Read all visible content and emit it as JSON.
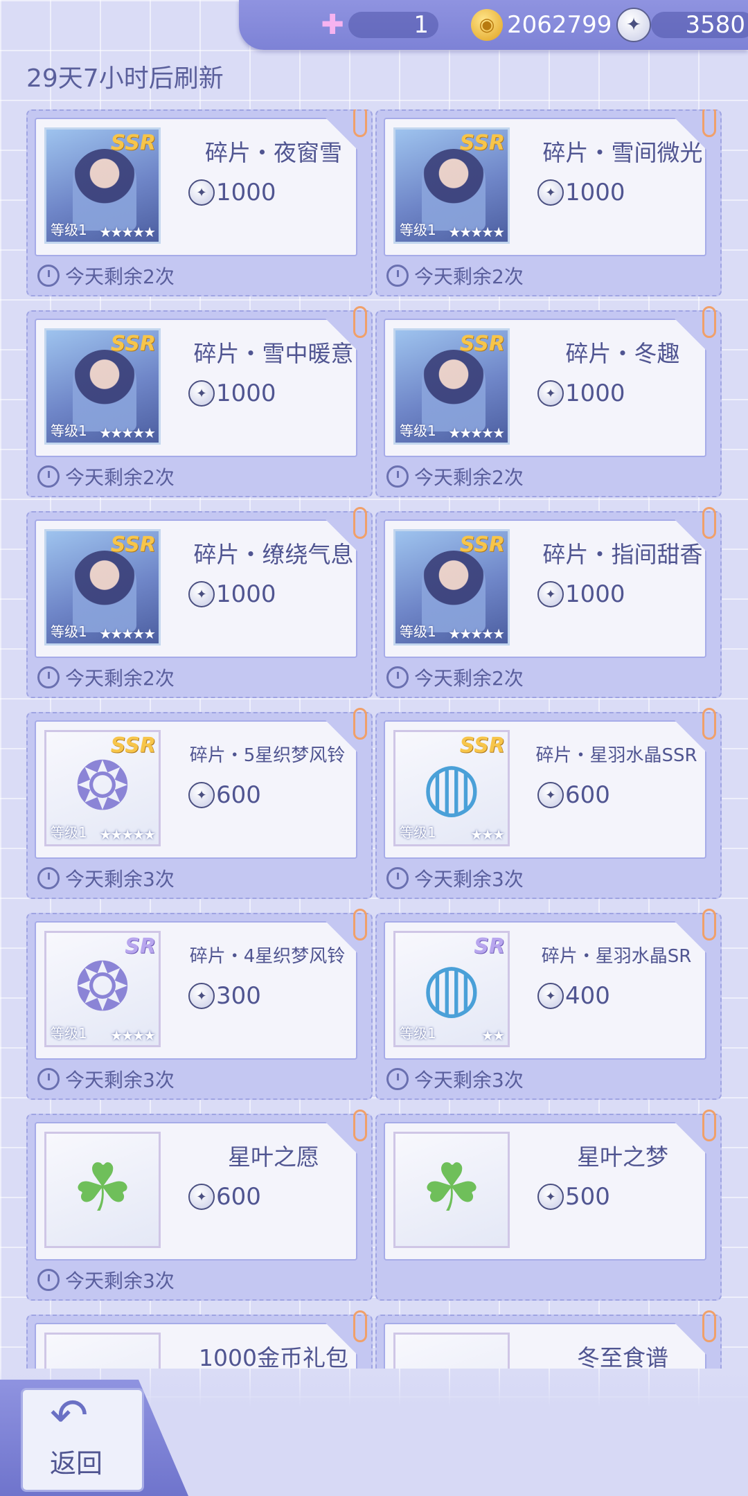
{
  "currency": {
    "swan": {
      "icon": "swan-plus-icon",
      "value": "1"
    },
    "coins": {
      "icon": "gold-coin-icon",
      "value": "2062799"
    },
    "stars": {
      "icon": "star-coin-icon",
      "value": "3580"
    }
  },
  "refresh_text": "29天7小时后刷新",
  "cards": [
    {
      "name": "碎片・夜窗雪",
      "price": "1000",
      "limit": "今天剩余2次",
      "rarity": "SSR",
      "level": "等级1",
      "stars": "★★★★★",
      "thumb": "character"
    },
    {
      "name": "碎片・雪间微光",
      "price": "1000",
      "limit": "今天剩余2次",
      "rarity": "SSR",
      "level": "等级1",
      "stars": "★★★★★",
      "thumb": "character"
    },
    {
      "name": "碎片・雪中暖意",
      "price": "1000",
      "limit": "今天剩余2次",
      "rarity": "SSR",
      "level": "等级1",
      "stars": "★★★★★",
      "thumb": "character"
    },
    {
      "name": "碎片・冬趣",
      "price": "1000",
      "limit": "今天剩余2次",
      "rarity": "SSR",
      "level": "等级1",
      "stars": "★★★★★",
      "thumb": "character"
    },
    {
      "name": "碎片・缭绕气息",
      "price": "1000",
      "limit": "今天剩余2次",
      "rarity": "SSR",
      "level": "等级1",
      "stars": "★★★★★",
      "thumb": "character"
    },
    {
      "name": "碎片・指间甜香",
      "price": "1000",
      "limit": "今天剩余2次",
      "rarity": "SSR",
      "level": "等级1",
      "stars": "★★★★★",
      "thumb": "character"
    },
    {
      "name": "碎片・5星织梦风铃",
      "price": "600",
      "limit": "今天剩余3次",
      "rarity": "SSR",
      "level": "等级1",
      "stars": "★★★★★",
      "thumb": "dreamcatcher"
    },
    {
      "name": "碎片・星羽水晶SSR",
      "price": "600",
      "limit": "今天剩余3次",
      "rarity": "SSR",
      "level": "等级1",
      "stars": "★★★",
      "thumb": "crystal"
    },
    {
      "name": "碎片・4星织梦风铃",
      "price": "300",
      "limit": "今天剩余3次",
      "rarity": "SR",
      "level": "等级1",
      "stars": "★★★★",
      "thumb": "dreamcatcher"
    },
    {
      "name": "碎片・星羽水晶SR",
      "price": "400",
      "limit": "今天剩余3次",
      "rarity": "SR",
      "level": "等级1",
      "stars": "★★",
      "thumb": "crystal"
    },
    {
      "name": "星叶之愿",
      "price": "600",
      "limit": "今天剩余3次",
      "rarity": "",
      "level": "",
      "stars": "",
      "thumb": "clover-jar"
    },
    {
      "name": "星叶之梦",
      "price": "500",
      "limit": "",
      "rarity": "",
      "level": "",
      "stars": "",
      "thumb": "clover-bowl"
    },
    {
      "name": "1000金币礼包",
      "price": "",
      "limit": "",
      "rarity": "",
      "level": "",
      "stars": "",
      "thumb": "coin-pack"
    },
    {
      "name": "冬至食谱",
      "price": "",
      "limit": "",
      "rarity": "",
      "level": "",
      "stars": "",
      "thumb": "recipe"
    }
  ],
  "back_label": "返回",
  "icons": {
    "price": "star-coin-icon",
    "limit": "clock-icon",
    "back": "back-arrow-icon",
    "clip": "paperclip-icon"
  },
  "colors": {
    "accent": "#7d82d6",
    "text": "#505591",
    "ssr_badge": "#f7c54a",
    "sr_badge": "#b8a6ee"
  }
}
